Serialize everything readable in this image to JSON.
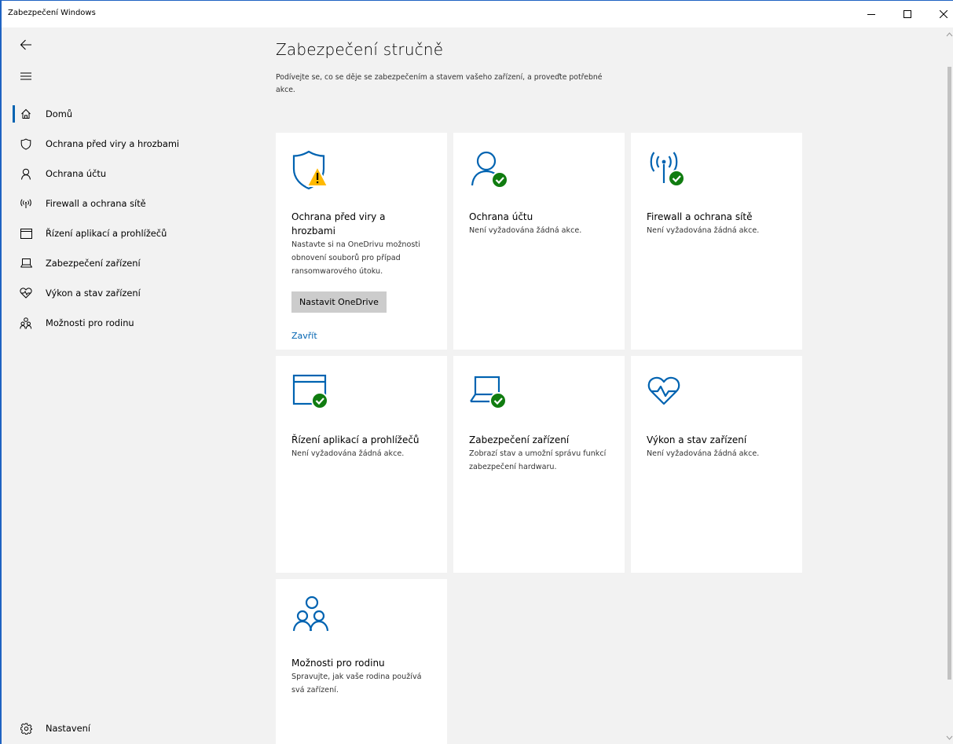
{
  "window": {
    "title": "Zabezpečení Windows"
  },
  "sidebar": {
    "items": [
      {
        "label": "Domů",
        "icon": "home-icon"
      },
      {
        "label": "Ochrana před viry a hrozbami",
        "icon": "shield-icon"
      },
      {
        "label": "Ochrana účtu",
        "icon": "person-icon"
      },
      {
        "label": "Firewall a ochrana sítě",
        "icon": "antenna-icon"
      },
      {
        "label": "Řízení aplikací a prohlížečů",
        "icon": "browser-window-icon"
      },
      {
        "label": "Zabezpečení zařízení",
        "icon": "laptop-icon"
      },
      {
        "label": "Výkon a stav zařízení",
        "icon": "heart-pulse-icon"
      },
      {
        "label": "Možnosti pro rodinu",
        "icon": "family-icon"
      }
    ],
    "settings_label": "Nastavení"
  },
  "main": {
    "title": "Zabezpečení stručně",
    "subtitle": "Podívejte se, co se děje se zabezpečením a stavem vašeho zařízení, a proveďte potřebné akce.",
    "tiles": [
      {
        "title": "Ochrana před viry a hrozbami",
        "desc": "Nastavte si na OneDrivu možnosti obnovení souborů pro případ ransomwarového útoku.",
        "button": "Nastavit OneDrive",
        "link": "Zavřít",
        "icon": "shield-warning-icon",
        "status": "warning"
      },
      {
        "title": "Ochrana účtu",
        "desc": "Není vyžadována žádná akce.",
        "icon": "person-check-icon",
        "status": "ok"
      },
      {
        "title": "Firewall a ochrana sítě",
        "desc": "Není vyžadována žádná akce.",
        "icon": "antenna-check-icon",
        "status": "ok"
      },
      {
        "title": "Řízení aplikací a prohlížečů",
        "desc": "Není vyžadována žádná akce.",
        "icon": "browser-check-icon",
        "status": "ok"
      },
      {
        "title": "Zabezpečení zařízení",
        "desc": "Zobrazí stav a umožní správu funkcí zabezpečení hardwaru.",
        "icon": "laptop-check-icon",
        "status": "ok"
      },
      {
        "title": "Výkon a stav zařízení",
        "desc": "Není vyžadována žádná akce.",
        "icon": "heart-pulse-icon",
        "status": "none"
      },
      {
        "title": "Možnosti pro rodinu",
        "desc": "Spravujte, jak vaše rodina používá svá zařízení.",
        "icon": "family-icon",
        "status": "none"
      }
    ]
  },
  "colors": {
    "accent": "#0063b1",
    "ok": "#107c10",
    "warning": "#ffb900",
    "sidebar_bg": "#f2f2f2",
    "tile_bg": "#ffffff",
    "window_border": "#1f63c2"
  }
}
